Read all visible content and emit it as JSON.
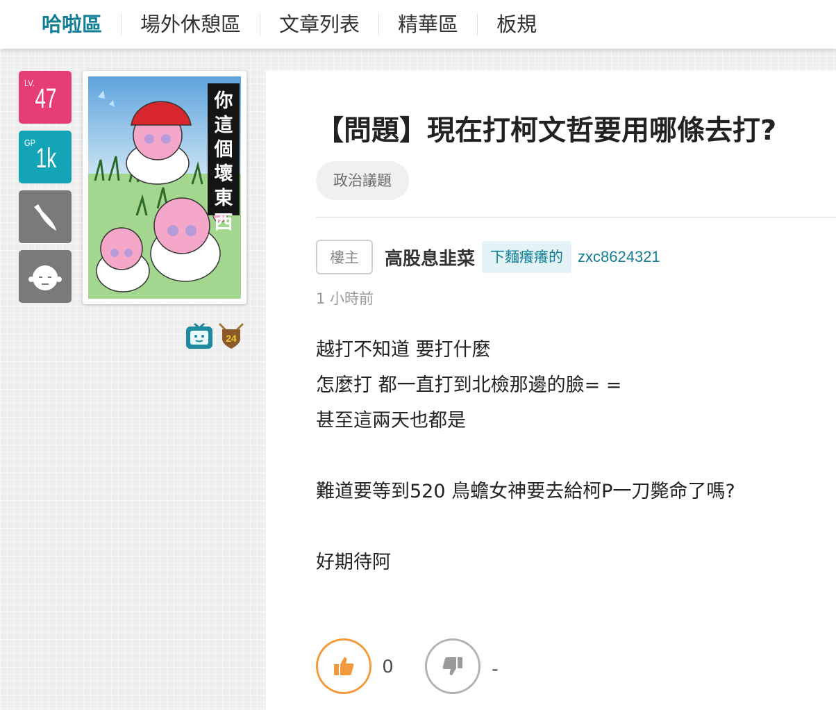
{
  "nav": {
    "items": [
      {
        "label": "哈啦區",
        "active": true
      },
      {
        "label": "場外休憩區"
      },
      {
        "label": "文章列表"
      },
      {
        "label": "精華區"
      },
      {
        "label": "板規"
      }
    ]
  },
  "user_badges": {
    "level_prefix": "LV.",
    "level": "47",
    "gp_prefix": "GP",
    "gp": "1k",
    "icons": [
      "knife-icon",
      "face-icon"
    ],
    "colors": {
      "level": "#e63d78",
      "gp": "#13a5b5",
      "gray": "#7a7a7a"
    }
  },
  "avatar": {
    "caption": [
      "你",
      "這",
      "個",
      "壞",
      "東",
      "西"
    ]
  },
  "medals": [
    "tv-medal-icon",
    "shield-24-medal-icon"
  ],
  "post": {
    "title": "【問題】現在打柯文哲要用哪條去打?",
    "tag": "政治議題",
    "op_label": "樓主",
    "author_name": "高股息韭菜",
    "author_title": "下麵癢癢的",
    "author_id": "zxc8624321",
    "time": "1 小時前",
    "content": [
      "越打不知道 要打什麼",
      "怎麼打 都一直打到北檢那邊的臉= =",
      "甚至這兩天也都是",
      "",
      "難道要等到520 鳥蟾女神要去給柯P一刀斃命了嗎?",
      "",
      "好期待阿"
    ],
    "upvotes": "0",
    "downvotes": "-",
    "colors": {
      "accent": "#117e96",
      "upvote": "#f39a3c",
      "downvote": "#b3b3b3"
    }
  }
}
